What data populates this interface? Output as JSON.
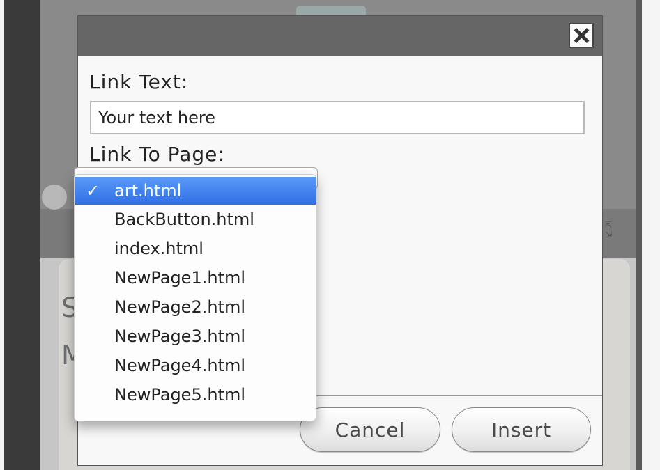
{
  "dialog": {
    "close_icon": "close-icon",
    "link_text_label": "Link Text:",
    "link_text_value": "Your text here",
    "link_to_page_label": "Link To Page:",
    "cancel_label": "Cancel",
    "insert_label": "Insert"
  },
  "dropdown": {
    "selected_mark": "✓",
    "options": [
      {
        "label": "art.html",
        "selected": true
      },
      {
        "label": "BackButton.html",
        "selected": false
      },
      {
        "label": "index.html",
        "selected": false
      },
      {
        "label": "NewPage1.html",
        "selected": false
      },
      {
        "label": "NewPage2.html",
        "selected": false
      },
      {
        "label": "NewPage3.html",
        "selected": false
      },
      {
        "label": "NewPage4.html",
        "selected": false
      },
      {
        "label": "NewPage5.html",
        "selected": false
      }
    ],
    "selected_color": "#3a7df0"
  },
  "background": {
    "letter_s": "S",
    "letter_m": "M",
    "expand_icon": "expand-icon"
  }
}
